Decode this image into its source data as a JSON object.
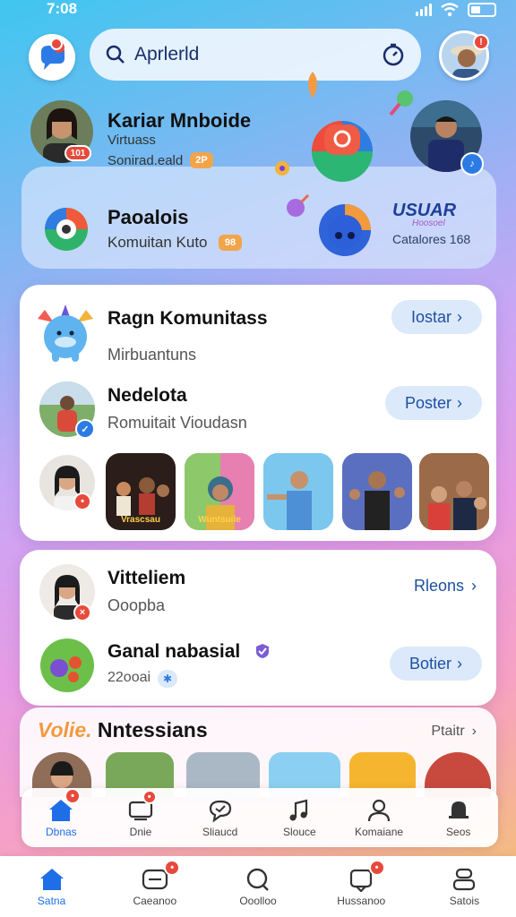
{
  "status": {
    "time": "7:08"
  },
  "search": {
    "query": "Aprlerld"
  },
  "hero": {
    "user1": {
      "name": "Kariar Mnboide",
      "line1": "Virtuass",
      "line2": "Sonirad.eald",
      "badge": "101",
      "chip": "2P"
    },
    "panel": {
      "title": "Paoalois",
      "subtitle": "Komuitan Kuto",
      "chip": "98"
    },
    "brand": {
      "name": "USUAR",
      "sub1": "Hoosoel",
      "sub2": "Catalores 168"
    }
  },
  "card1": {
    "row1": {
      "title": "Ragn Komunitass",
      "subtitle": "Mirbuantuns",
      "button": "Iostar"
    },
    "row2": {
      "title": "Nedelota",
      "subtitle": "Romuitait Vioudasn",
      "button": "Poster"
    },
    "tiles": [
      "Vrascsau",
      "Wuntsuile",
      "",
      "",
      "",
      ""
    ]
  },
  "card2": {
    "row1": {
      "title": "Vitteliem",
      "subtitle": "Ooopba",
      "link": "Rleons"
    },
    "row2": {
      "title": "Ganal nabasial",
      "subtitle": "22ooai",
      "button": "Botier"
    }
  },
  "section": {
    "title_accent": "Volie.",
    "title": "Nntessians",
    "link": "Ptaitr"
  },
  "tabbar_mid": [
    {
      "label": "Dbnas",
      "icon": "home-icon"
    },
    {
      "label": "Dnie",
      "icon": "chat-icon"
    },
    {
      "label": "Sliaucd",
      "icon": "bubble-icon"
    },
    {
      "label": "Slouce",
      "icon": "music-icon"
    },
    {
      "label": "Komaiane",
      "icon": "person-icon"
    },
    {
      "label": "Seos",
      "icon": "bell-icon"
    }
  ],
  "tabbar_bottom": [
    {
      "label": "Satna",
      "icon": "home-icon"
    },
    {
      "label": "Caeanoo",
      "icon": "message-icon"
    },
    {
      "label": "Ooolloo",
      "icon": "search-icon"
    },
    {
      "label": "Hussanoo",
      "icon": "inbox-icon"
    },
    {
      "label": "Satois",
      "icon": "profile-icon"
    }
  ],
  "colors": {
    "accent": "#1e6ee8",
    "badge": "#e74a3c",
    "button_bg": "#dce9fb",
    "button_text": "#1d4fa3"
  }
}
